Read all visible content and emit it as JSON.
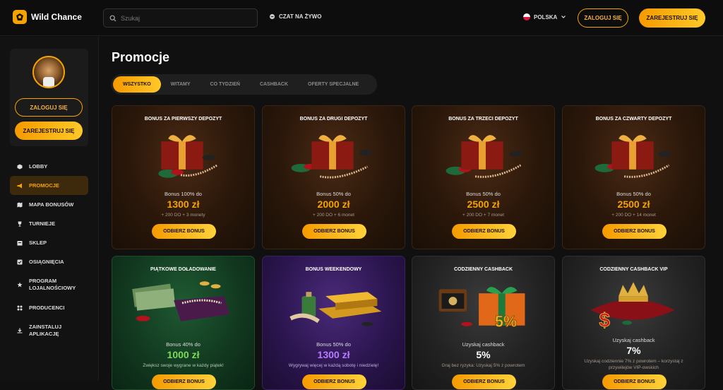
{
  "header": {
    "brand": "Wild Chance",
    "search_placeholder": "Szukaj",
    "chat_label": "CZAT NA ŻYWO",
    "language": "POLSKA",
    "login_label": "ZALOGUJ SIĘ",
    "register_label": "ZAREJESTRUJ SIĘ"
  },
  "sidebar": {
    "login_label": "ZALOGUJ SIĘ",
    "register_label": "ZAREJESTRUJ SIĘ",
    "items": [
      {
        "label": "LOBBY",
        "icon": "cube-icon"
      },
      {
        "label": "PROMOCJE",
        "icon": "megaphone-icon",
        "active": true
      },
      {
        "label": "MAPA BONUSÓW",
        "icon": "map-icon"
      },
      {
        "label": "TURNIEJE",
        "icon": "trophy-icon"
      },
      {
        "label": "SKLEP",
        "icon": "shop-icon"
      },
      {
        "label": "OSIĄGNIĘCIA",
        "icon": "achievement-icon"
      },
      {
        "label": "PROGRAM LOJALNOŚCIOWY",
        "icon": "loyalty-icon"
      },
      {
        "label": "PRODUCENCI",
        "icon": "grid-icon"
      },
      {
        "label": "ZAINSTALUJ APLIKACJĘ",
        "icon": "download-icon"
      }
    ]
  },
  "main": {
    "title": "Promocje",
    "tabs": [
      "WSZYSTKO",
      "WITAMY",
      "CO TYDZIEŃ",
      "CASHBACK",
      "OFERTY SPECJALNE"
    ],
    "active_tab": "WSZYSTKO"
  },
  "cards": [
    {
      "title": "BONUS ZA PIERWSZY DEPOZYT",
      "sub": "Bonus 100% do",
      "amount": "1300 zł",
      "note": "+ 200 DO + 3 monety",
      "button": "ODBIERZ BONUS",
      "theme": "deposit"
    },
    {
      "title": "BONUS ZA DRUGI DEPOZYT",
      "sub": "Bonus 50% do",
      "amount": "2000 zł",
      "note": "+ 200 DO + 6 monet",
      "button": "ODBIERZ BONUS",
      "theme": "deposit"
    },
    {
      "title": "BONUS ZA TRZECI DEPOZYT",
      "sub": "Bonus 50% do",
      "amount": "2500 zł",
      "note": "+ 200 DO + 7 monet",
      "button": "ODBIERZ BONUS",
      "theme": "deposit"
    },
    {
      "title": "BONUS ZA CZWARTY DEPOZYT",
      "sub": "Bonus 50% do",
      "amount": "2500 zł",
      "note": "+ 200 DO + 14 monet",
      "button": "ODBIERZ BONUS",
      "theme": "deposit"
    },
    {
      "title": "PIĄTKOWE DOŁADOWANIE",
      "sub": "Bonus 40% do",
      "amount": "1000 zł",
      "note": "Zwiększ swoje wygrane w każdy piątek!",
      "button": "ODBIERZ BONUS",
      "theme": "green",
      "amount_color": "#7ed957"
    },
    {
      "title": "BONUS WEEKENDOWY",
      "sub": "Bonus 50% do",
      "amount": "1300 zł",
      "note": "Wygrywaj więcej w każdą sobotę i niedzielę!",
      "button": "ODBIERZ BONUS",
      "theme": "purple",
      "amount_color": "#b67bff"
    },
    {
      "title": "CODZIENNY CASHBACK",
      "sub": "Uzyskaj cashback",
      "amount": "5%",
      "note": "Graj bez ryzyka: Uzyskaj 5% z powrotem",
      "button": "ODBIERZ BONUS",
      "theme": "dark",
      "badge": "5%"
    },
    {
      "title": "CODZIENNY CASHBACK VIP",
      "sub": "Uzyskaj cashback",
      "amount": "7%",
      "note": "Uzyskaj codziennie 7% z powrotem – korzystaj z przywilejów VIP-owskich",
      "button": "ODBIERZ BONUS",
      "theme": "dark"
    }
  ],
  "colors": {
    "accent": "#f5a300",
    "accent_light": "#ffc928"
  }
}
